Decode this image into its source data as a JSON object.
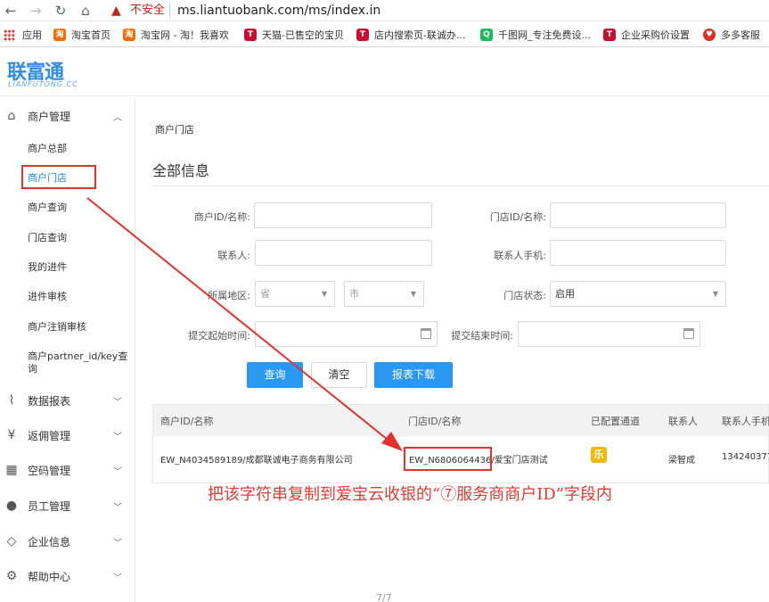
{
  "browser": {
    "back_icon": "arrow-left",
    "forward_icon": "arrow-right",
    "reload_icon": "reload",
    "home_icon": "home",
    "security_label": "不安全",
    "url": "ms.liantuobank.com/ms/index.in"
  },
  "bookmarks": [
    {
      "label": "应用",
      "icon": "apps-grid"
    },
    {
      "label": "淘宝首页",
      "icon": "taobao",
      "color": "#ff6a00"
    },
    {
      "label": "淘宝网 - 淘！我喜欢",
      "icon": "taobao",
      "color": "#ff6a00"
    },
    {
      "label": "天猫-已售空的宝贝",
      "icon": "tmall-t",
      "color": "#c8102e"
    },
    {
      "label": "店内搜索页-联诚办...",
      "icon": "tmall-t",
      "color": "#c8102e"
    },
    {
      "label": "千图网_专注免费设...",
      "icon": "qiantu",
      "color": "#1cba5a"
    },
    {
      "label": "企业采购价设置",
      "icon": "tmall-t",
      "color": "#c8102e"
    },
    {
      "label": "多多客服",
      "icon": "pinduoduo",
      "color": "#e02e24"
    }
  ],
  "logo": {
    "main": "联富通",
    "sub": "LIANFUTONG.CC"
  },
  "sidebar": {
    "groups": [
      {
        "label": "商户管理",
        "icon": "home-icon",
        "expanded": true
      },
      {
        "label": "数据报表",
        "icon": "chart-icon"
      },
      {
        "label": "返佣管理",
        "icon": "commission-icon"
      },
      {
        "label": "空码管理",
        "icon": "qrcode-icon"
      },
      {
        "label": "员工管理",
        "icon": "user-icon"
      },
      {
        "label": "企业信息",
        "icon": "enterprise-icon"
      },
      {
        "label": "帮助中心",
        "icon": "help-icon"
      }
    ],
    "items": [
      "商户总部",
      "商户门店",
      "商户查询",
      "门店查询",
      "我的进件",
      "进件审核",
      "商户注销审核",
      "商户partner_id/key查",
      "询"
    ],
    "active_item": "商户门店"
  },
  "main": {
    "breadcrumb": "商户门店",
    "section_title": "全部信息",
    "form": {
      "merchant_label": "商户ID/名称:",
      "merchant_value": "",
      "store_label": "门店ID/名称:",
      "store_value": "",
      "contact_label": "联系人:",
      "contact_value": "",
      "phone_label": "联系人手机:",
      "phone_value": "",
      "region_label": "所属地区:",
      "province_placeholder": "省",
      "city_placeholder": "市",
      "status_label": "门店状态:",
      "status_value": "启用",
      "start_label": "提交起始时间:",
      "end_label": "提交结束时间:"
    },
    "buttons": {
      "query": "查询",
      "clear": "清空",
      "download": "报表下载"
    },
    "table": {
      "headers": [
        "商户ID/名称",
        "门店ID/名称",
        "已配置通道",
        "联系人",
        "联系人手机"
      ],
      "rows": [
        {
          "merchant": "EW_N4034589189/成都联诚电子商务有限公司",
          "store_id": "EW_N6806064436",
          "store_name": "/爱宝门店测试",
          "channel_badge": "乐",
          "contact": "梁智成",
          "phone": "134240377"
        }
      ]
    },
    "pager": "7/7"
  },
  "annotation": {
    "text": "把该字符串复制到爱宝云收银的“⑦服务商商户ID”字段内",
    "color": "#e23a32"
  }
}
